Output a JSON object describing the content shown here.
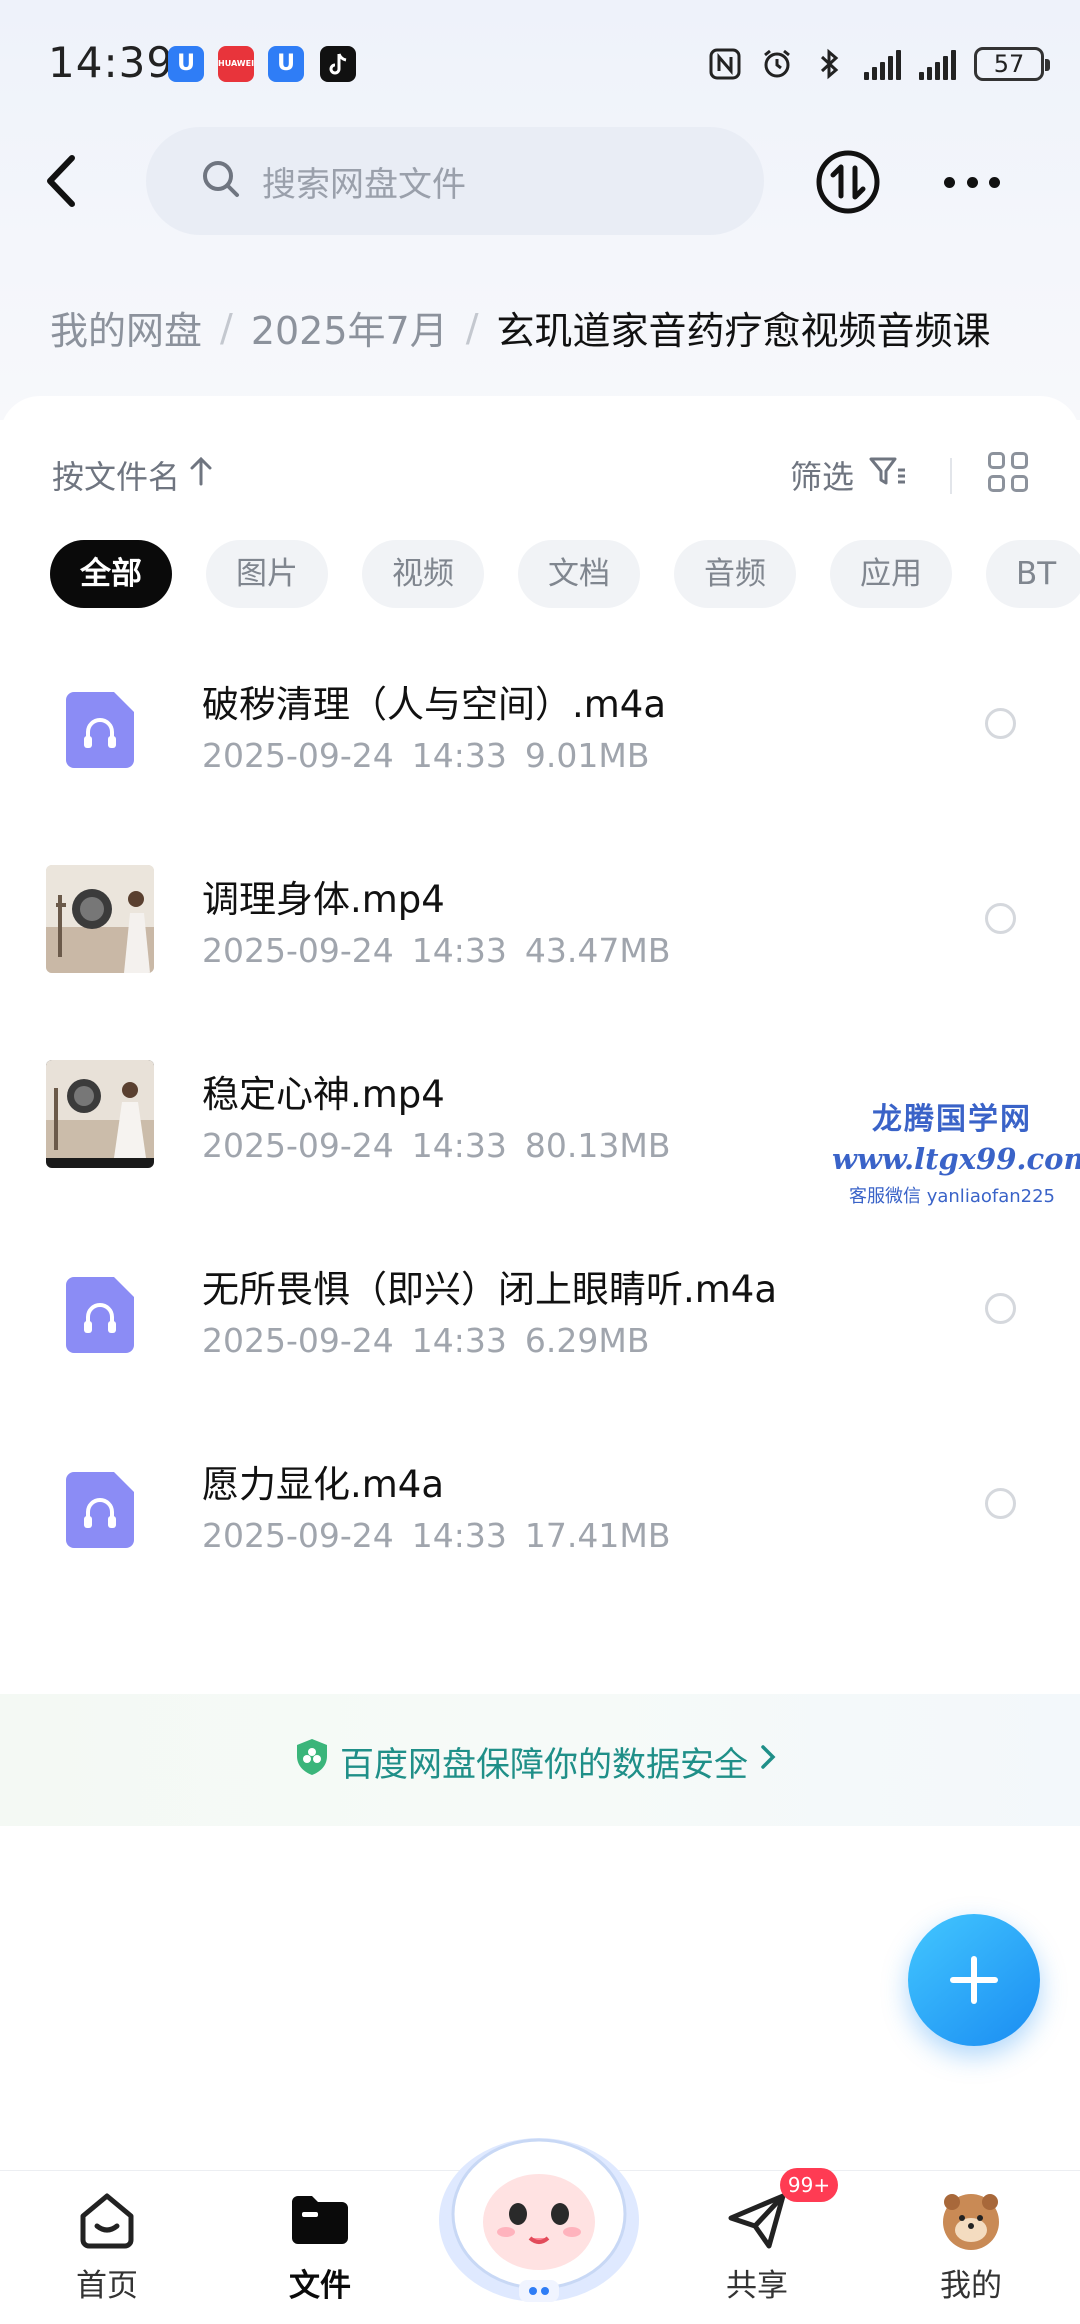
{
  "status_bar": {
    "time": "14:39",
    "battery": "57",
    "huawei_badge_text": "HUAWEI"
  },
  "header": {
    "search_placeholder": "搜索网盘文件"
  },
  "breadcrumb": {
    "root": "我的网盘",
    "parent": "2025年7月",
    "current": "玄玑道家音药疗愈视频音频课",
    "separator": "/"
  },
  "toolbar": {
    "sort_label": "按文件名",
    "filter_label": "筛选"
  },
  "tabs": [
    {
      "label": "全部",
      "active": true
    },
    {
      "label": "图片",
      "active": false
    },
    {
      "label": "视频",
      "active": false
    },
    {
      "label": "文档",
      "active": false
    },
    {
      "label": "音频",
      "active": false
    },
    {
      "label": "应用",
      "active": false
    },
    {
      "label": "BT",
      "active": false
    }
  ],
  "files": [
    {
      "name": "破秽清理（人与空间）.m4a",
      "date": "2025-09-24",
      "time": "14:33",
      "size": "9.01MB",
      "type": "audio"
    },
    {
      "name": "调理身体.mp4",
      "date": "2025-09-24",
      "time": "14:33",
      "size": "43.47MB",
      "type": "video"
    },
    {
      "name": "稳定心神.mp4",
      "date": "2025-09-24",
      "time": "14:33",
      "size": "80.13MB",
      "type": "video"
    },
    {
      "name": "无所畏惧（即兴）闭上眼睛听.m4a",
      "date": "2025-09-24",
      "time": "14:33",
      "size": "6.29MB",
      "type": "audio"
    },
    {
      "name": "愿力显化.m4a",
      "date": "2025-09-24",
      "time": "14:33",
      "size": "17.41MB",
      "type": "audio"
    }
  ],
  "watermark": {
    "title": "龙腾国学网",
    "url": "www.ltgx99.com",
    "wechat": "客服微信 yanliaofan225"
  },
  "security_banner": {
    "text": "百度网盘保障你的数据安全"
  },
  "bottom_nav": {
    "home": "首页",
    "files": "文件",
    "share": "共享",
    "mine": "我的",
    "share_badge": "99+"
  },
  "colors": {
    "accent": "#1a8cf2",
    "audio_icon": "#8b8cf5",
    "security_text": "#1f8f88",
    "badge": "#ff3b53"
  }
}
